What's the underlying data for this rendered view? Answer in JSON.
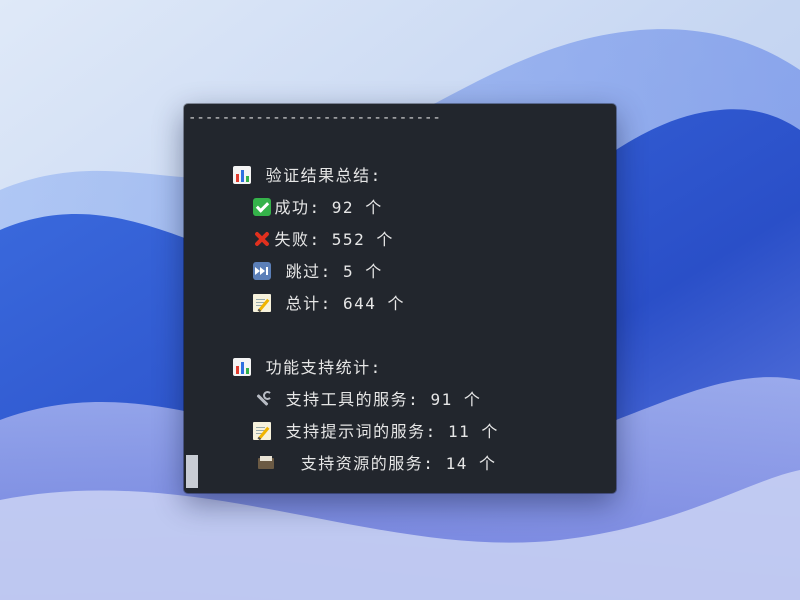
{
  "terminal": {
    "separator": "------------------------------",
    "summary": {
      "heading": "验证结果总结:",
      "heading_icon": "bar-chart-icon",
      "items": [
        {
          "icon": "check-mark-icon",
          "label": "成功: 92 个"
        },
        {
          "icon": "cross-mark-icon",
          "label": "失败: 552 个"
        },
        {
          "icon": "fast-forward-icon",
          "label": "跳过: 5 个"
        },
        {
          "icon": "memo-icon",
          "label": "总计: 644 个"
        }
      ]
    },
    "features": {
      "heading": "功能支持统计:",
      "heading_icon": "bar-chart-icon",
      "items": [
        {
          "icon": "wrench-icon",
          "label": "支持工具的服务: 91 个"
        },
        {
          "icon": "memo-icon",
          "label": "支持提示词的服务: 11 个"
        },
        {
          "icon": "card-file-box-icon",
          "label": "支持资源的服务: 14 个"
        }
      ]
    }
  },
  "colors": {
    "terminal_bg": "#22262d",
    "text": "#e6e6e6",
    "cursor": "#c8ccd4",
    "success": "#35b24a",
    "failure": "#e0301e"
  }
}
